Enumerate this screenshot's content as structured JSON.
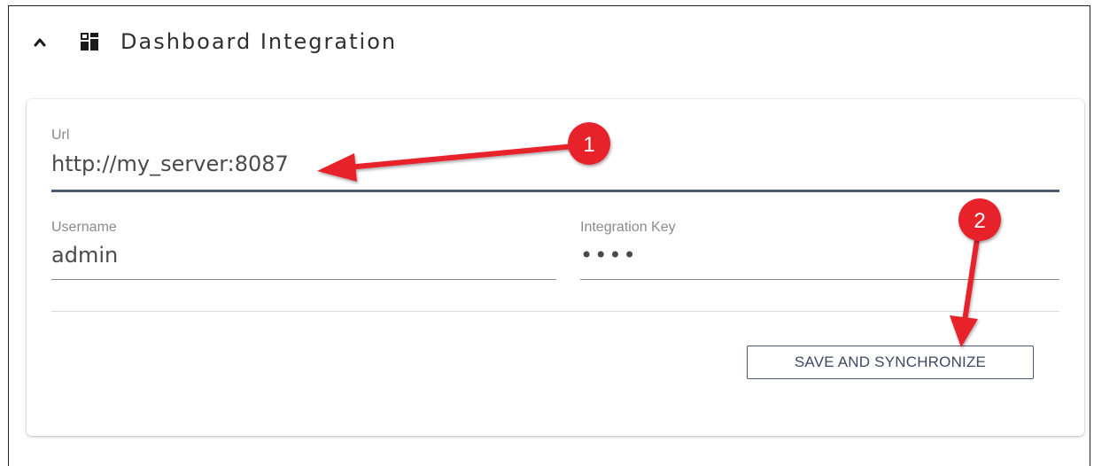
{
  "section": {
    "title": "Dashboard Integration",
    "collapse_icon": "chevron-up-icon",
    "icon": "dashboard-icon"
  },
  "form": {
    "url": {
      "label": "Url",
      "value": "http://my_server:8087"
    },
    "username": {
      "label": "Username",
      "value": "admin"
    },
    "integration_key": {
      "label": "Integration Key",
      "value": "••••"
    },
    "save_button": "SAVE AND SYNCHRONIZE"
  },
  "annotations": {
    "color": "#e8232a",
    "markers": [
      {
        "label": "1",
        "points_to": "url-input"
      },
      {
        "label": "2",
        "points_to": "save-and-synchronize-button"
      }
    ]
  }
}
